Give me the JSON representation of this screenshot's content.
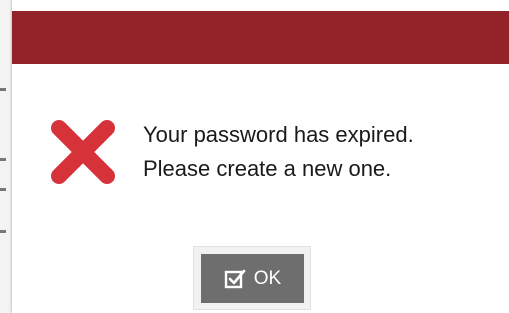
{
  "dialog": {
    "message_line1": "Your password has expired.",
    "message_line2": "Please create a new one.",
    "icon": "error-x-icon",
    "ok_label": "OK",
    "ok_icon": "checkbox-check-icon"
  },
  "colors": {
    "title_bar": "#922329",
    "error_icon": "#d6323a",
    "button_bg": "#6e6e6e",
    "button_text": "#ffffff"
  }
}
